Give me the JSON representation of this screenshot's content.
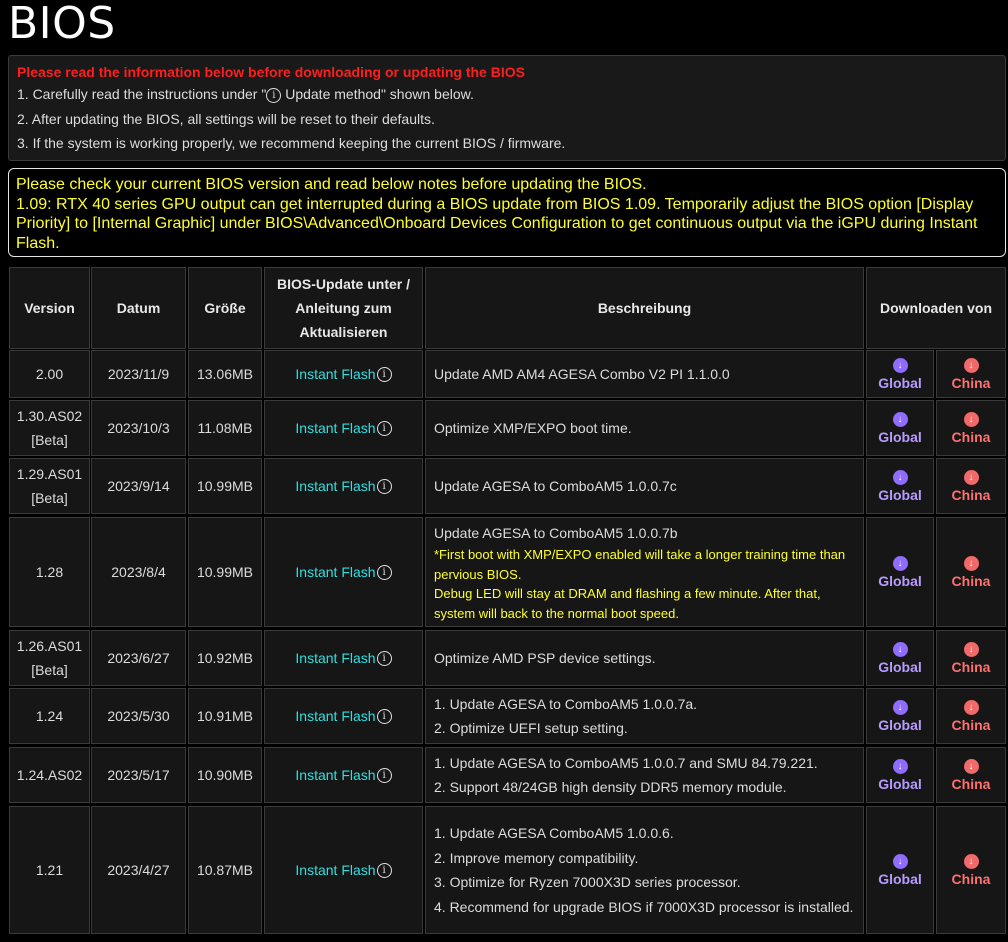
{
  "page": {
    "title": "BIOS"
  },
  "notice": {
    "warning": "Please read the information below before downloading or updating the BIOS",
    "line1_pre": "1. Carefully read the instructions under \"",
    "line1_post": " Update method\" shown below.",
    "line2": "2. After updating the BIOS, all settings will be reset to their defaults.",
    "line3": "3. If the system is working properly, we recommend keeping the current BIOS / firmware."
  },
  "notice2": {
    "line1": "Please check your current BIOS version and read below notes before updating the BIOS.",
    "line2": "1.09: RTX 40 series GPU output can get interrupted during a BIOS update from BIOS 1.09. Temporarily adjust the BIOS option [Display Priority] to [Internal Graphic] under BIOS\\Advanced\\Onboard Devices Configuration to get continuous output via the iGPU during Instant Flash."
  },
  "table": {
    "headers": {
      "version": "Version",
      "date": "Datum",
      "size": "Größe",
      "method": "BIOS-Update unter / Anleitung zum Aktualisieren",
      "description": "Beschreibung",
      "download": "Downloaden von"
    },
    "info_glyph": "i",
    "download_glyph": "↓",
    "rows": [
      {
        "version": "2.00",
        "date": "2023/11/9",
        "size": "13.06MB",
        "method": "Instant Flash",
        "description": [
          "Update AMD AM4 AGESA Combo V2 PI 1.1.0.0"
        ],
        "notes": [],
        "global": "Global",
        "china": "China"
      },
      {
        "version": "1.30.AS02",
        "tag": "[Beta]",
        "date": "2023/10/3",
        "size": "11.08MB",
        "method": "Instant Flash",
        "description": [
          "Optimize XMP/EXPO boot time."
        ],
        "notes": [],
        "global": "Global",
        "china": "China"
      },
      {
        "version": "1.29.AS01",
        "tag": "[Beta]",
        "date": "2023/9/14",
        "size": "10.99MB",
        "method": "Instant Flash",
        "description": [
          "Update AGESA to ComboAM5 1.0.0.7c"
        ],
        "notes": [],
        "global": "Global",
        "china": "China"
      },
      {
        "version": "1.28",
        "date": "2023/8/4",
        "size": "10.99MB",
        "method": "Instant Flash",
        "description": [
          "Update AGESA to ComboAM5 1.0.0.7b"
        ],
        "notes": [
          "*First boot with XMP/EXPO enabled will take a longer training time than pervious BIOS.",
          "Debug LED will stay at DRAM and flashing a few minute. After that, system will back to the normal boot speed."
        ],
        "global": "Global",
        "china": "China"
      },
      {
        "version": "1.26.AS01",
        "tag": "[Beta]",
        "date": "2023/6/27",
        "size": "10.92MB",
        "method": "Instant Flash",
        "description": [
          "Optimize AMD PSP device settings."
        ],
        "notes": [],
        "global": "Global",
        "china": "China"
      },
      {
        "version": "1.24",
        "date": "2023/5/30",
        "size": "10.91MB",
        "method": "Instant Flash",
        "description": [
          "1. Update AGESA to ComboAM5 1.0.0.7a.",
          "2. Optimize UEFI setup setting."
        ],
        "notes": [],
        "global": "Global",
        "china": "China"
      },
      {
        "version": "1.24.AS02",
        "date": "2023/5/17",
        "size": "10.90MB",
        "method": "Instant Flash",
        "description": [
          "1. Update AGESA to ComboAM5 1.0.0.7 and SMU 84.79.221.",
          "2. Support 48/24GB high density DDR5 memory module."
        ],
        "notes": [],
        "global": "Global",
        "china": "China"
      },
      {
        "version": "1.21",
        "date": "2023/4/27",
        "size": "10.87MB",
        "method": "Instant Flash",
        "description": [
          "1. Update AGESA ComboAM5 1.0.0.6.",
          "2. Improve memory compatibility.",
          "3. Optimize for Ryzen 7000X3D series processor.",
          "4. Recommend for upgrade BIOS if 7000X3D processor is installed."
        ],
        "notes": [],
        "global": "Global",
        "china": "China"
      }
    ]
  }
}
